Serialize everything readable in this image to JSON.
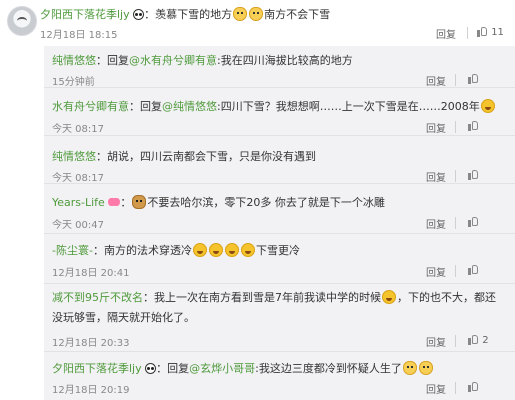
{
  "main_comment": {
    "username": "夕阳西下落花季ljy",
    "text_part1": "：羡慕下雪的地方",
    "text_part2": "南方不会下雪",
    "time": "12月18日 18:15",
    "reply_label": "回复",
    "like_count": "11"
  },
  "replies": [
    {
      "username": "纯情悠悠",
      "prefix": "：回复",
      "mention": "@水有舟兮卿有意",
      "text": ":我在四川海拔比较高的地方",
      "time": "15分钟前",
      "reply_label": "回复",
      "like_count": ""
    },
    {
      "username": "水有舟兮卿有意",
      "prefix": "：回复",
      "mention": "@纯情悠悠",
      "text": ":四川下雪？我想想啊……上一次下雪是在……2008年",
      "time": "今天 08:17",
      "reply_label": "回复",
      "like_count": ""
    },
    {
      "username": "纯情悠悠",
      "text": "：胡说，四川云南都会下雪，只是你没有遇到",
      "time": "今天 08:17",
      "reply_label": "回复",
      "like_count": ""
    },
    {
      "username": "Years-Life",
      "text_part1": "不要去哈尔滨，零下20多 你去了就是下一个冰雕",
      "time": "今天 00:47",
      "reply_label": "回复",
      "like_count": ""
    },
    {
      "username": "-陈尘寰-",
      "text_part1": "：南方的法术穿透冷",
      "text_part2": "下雪更冷",
      "time": "12月18日 20:41",
      "reply_label": "回复",
      "like_count": ""
    },
    {
      "username": "减不到95斤不改名",
      "text_line1": "：我上一次在南方看到雪是7年前我读中学的时候",
      "text_line1b": "，下的也不大，都还",
      "text_line2": "没玩够雪，隔天就开始化了。",
      "time": "12月18日 20:33",
      "reply_label": "回复",
      "like_count": "2"
    },
    {
      "username": "夕阳西下落花季ljy",
      "prefix": "：回复",
      "mention": "@玄烨小哥哥",
      "text": ":我这边三度都冷到怀疑人生了",
      "time": "12月18日 20:19",
      "reply_label": "回复",
      "like_count": ""
    }
  ],
  "icons": {
    "avatar": "avatar-icon",
    "panda": "panda-icon",
    "like": "thumbs-up-icon",
    "emoji_cat": "cat-emoji-icon",
    "emoji_laugh": "laugh-cry-emoji-icon",
    "emoji_dog": "dog-emoji-icon",
    "bow": "bow-icon"
  },
  "colors": {
    "username": "#4f9a3b",
    "thread_background": "#f2f2f5",
    "time_text": "#888888"
  }
}
